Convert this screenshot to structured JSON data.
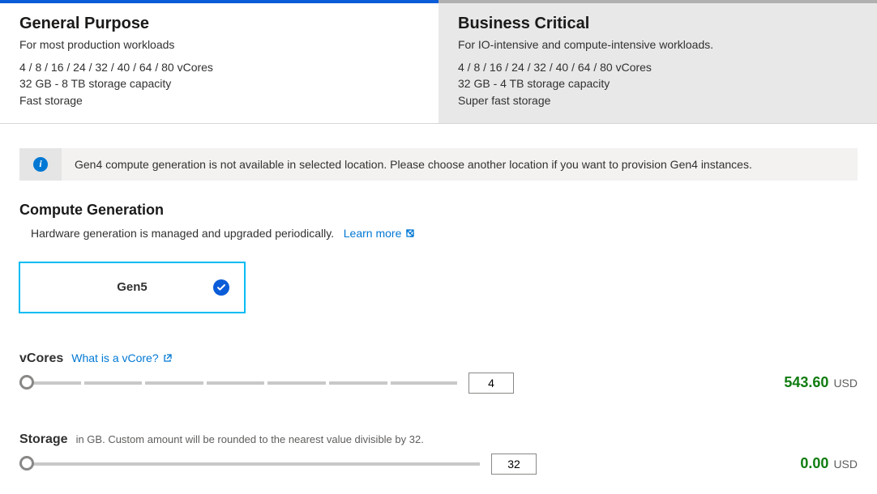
{
  "tiers": {
    "general": {
      "title": "General Purpose",
      "desc": "For most production workloads",
      "spec1": "4 / 8 / 16 / 24 / 32 / 40 / 64 / 80 vCores",
      "spec2": "32 GB - 8 TB storage capacity",
      "spec3": "Fast storage"
    },
    "business": {
      "title": "Business Critical",
      "desc": "For IO-intensive and compute-intensive workloads.",
      "spec1": "4 / 8 / 16 / 24 / 32 / 40 / 64 / 80 vCores",
      "spec2": "32 GB - 4 TB storage capacity",
      "spec3": "Super fast storage"
    }
  },
  "info_banner": "Gen4 compute generation is not available in selected location. Please choose another location if you want to provision Gen4 instances.",
  "compute_gen": {
    "title": "Compute Generation",
    "sub": "Hardware generation is managed and upgraded periodically.",
    "learn_more": "Learn more",
    "selected": "Gen5"
  },
  "vcores": {
    "title": "vCores",
    "link": "What is a vCore?",
    "value": "4",
    "price": "543.60",
    "currency": "USD"
  },
  "storage": {
    "title": "Storage",
    "note": "in GB. Custom amount will be rounded to the nearest value divisible by 32.",
    "value": "32",
    "price": "0.00",
    "currency": "USD"
  }
}
